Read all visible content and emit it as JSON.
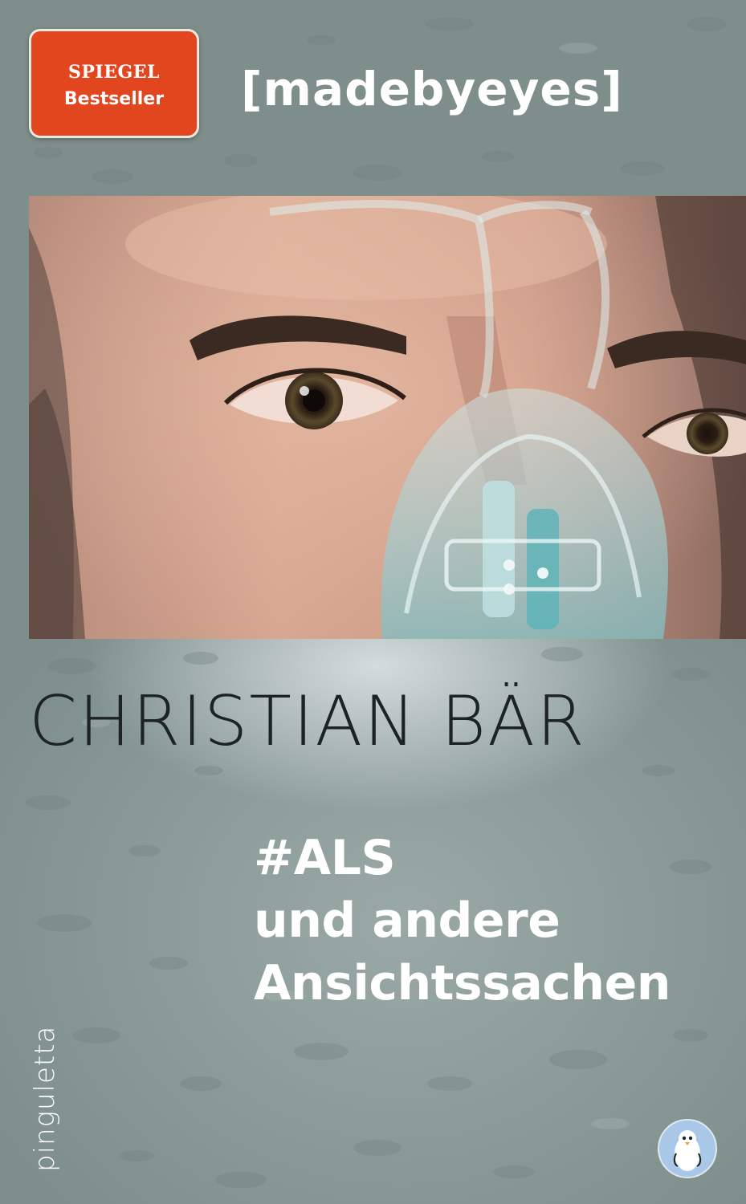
{
  "badge": {
    "line1": "SPIEGEL",
    "line2": "Bestseller"
  },
  "series": "[madebyeyes]",
  "author": "CHRISTIAN BÄR",
  "title": {
    "line1": "#ALS",
    "line2": "und andere",
    "line3": "Ansichtssachen"
  },
  "publisher": "pinguletta",
  "colors": {
    "background": "#8a9b98",
    "badge": "#e2461f",
    "title_text": "#ffffff",
    "author_text": "#1d2224",
    "logo_circle": "#a9c7e6"
  },
  "icons": {
    "publisher_logo": "penguin-icon"
  }
}
